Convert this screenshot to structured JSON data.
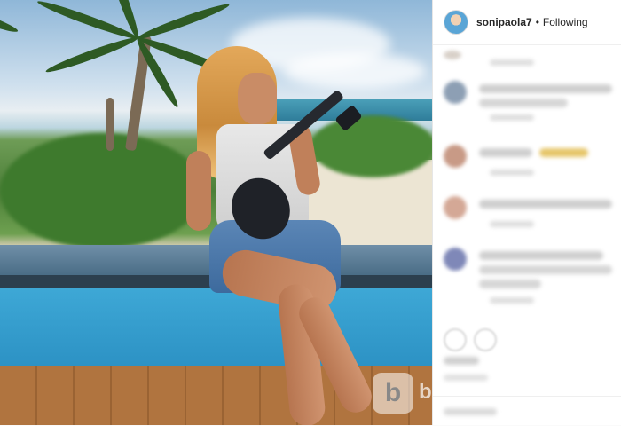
{
  "post": {
    "username": "sonipaola7",
    "separator": "•",
    "follow_status": "Following"
  },
  "watermark": {
    "glyph": "b",
    "tail": "b"
  },
  "icons": {
    "avatar": "profile-avatar",
    "like": "heart-icon",
    "comment": "comment-icon"
  },
  "colors": {
    "sidebar_bg": "#ffffff",
    "text": "#262626"
  }
}
